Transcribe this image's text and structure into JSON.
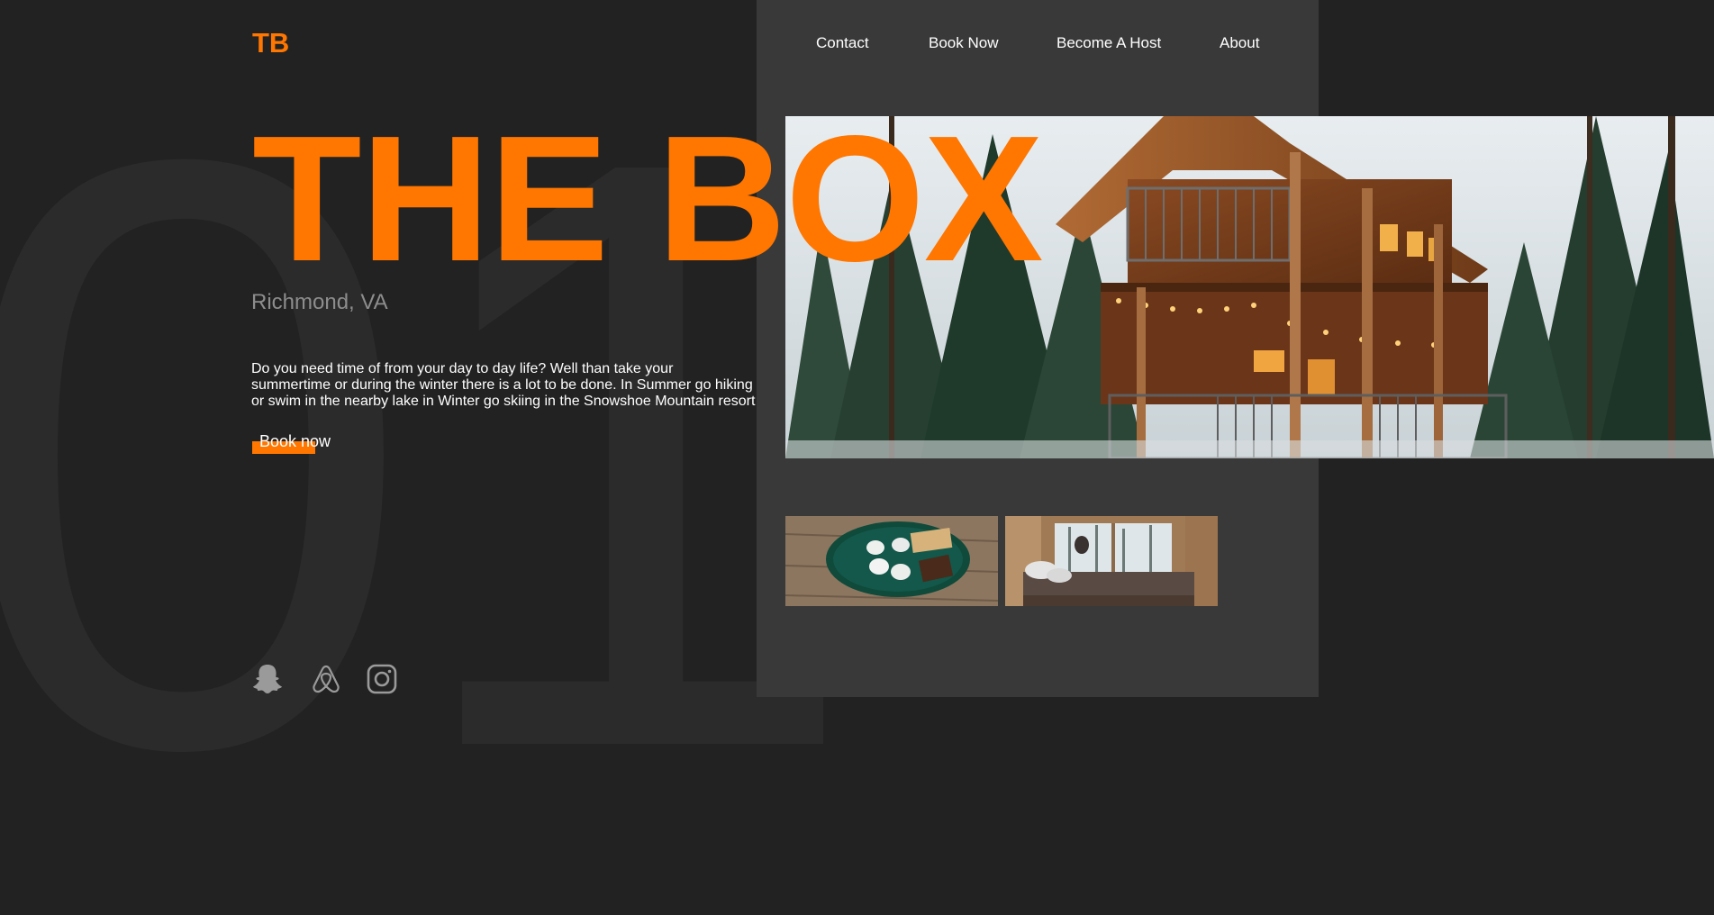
{
  "background": {
    "watermark_number": "01"
  },
  "header": {
    "logo": "TB",
    "nav": [
      "Contact",
      "Book Now",
      "Become A Host",
      "About"
    ]
  },
  "hero": {
    "title": "THE BOX",
    "location": "Richmond, VA",
    "description": "Do you need time of from your day to day life? Well than take your summertime or during the winter there is a lot to be done. In Summer go hiking or swim in the nearby lake in Winter go skiing in the Snowshoe Mountain resort",
    "cta_label": "Book now"
  },
  "gallery": {
    "main_image": "treehouse-cabin-photo",
    "thumbnails": [
      "smores-plate-photo",
      "cabin-bedroom-window-photo"
    ]
  },
  "social": [
    "snapchat-icon",
    "airbnb-icon",
    "instagram-icon"
  ],
  "colors": {
    "accent": "#ff7600",
    "background": "#222222",
    "panel": "#393939",
    "muted_text": "#8d8d8d",
    "text": "#ffffff"
  }
}
